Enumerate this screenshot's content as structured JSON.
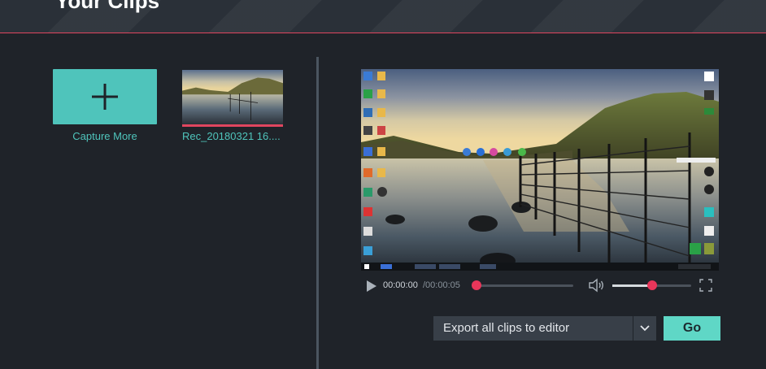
{
  "header": {
    "title": "Your Clips"
  },
  "clips": {
    "capture_more_label": "Capture More",
    "items": [
      {
        "name": "Rec_20180321 16...."
      }
    ]
  },
  "player": {
    "current_time": "00:00:00",
    "duration": "/00:00:05",
    "progress": 0.0,
    "volume": 0.5
  },
  "export": {
    "selected_option": "Export all clips to editor",
    "go_label": "Go"
  },
  "desktop_preview": {
    "taskbar_items": [
      "",
      "",
      "",
      "",
      ""
    ]
  },
  "colors": {
    "accent_teal": "#4fc4bb",
    "accent_red": "#e0465f",
    "go_button": "#5fd7c6",
    "background": "#1f2329"
  }
}
